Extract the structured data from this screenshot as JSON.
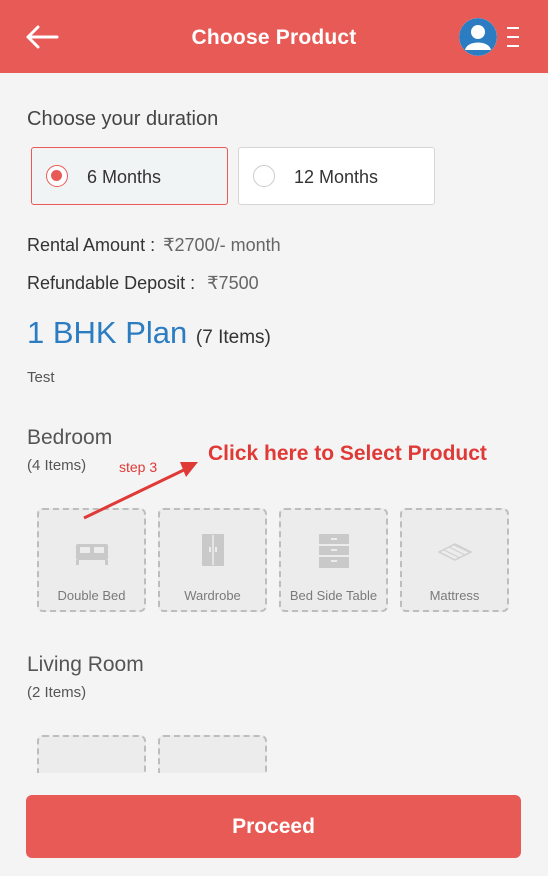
{
  "header": {
    "title": "Choose Product",
    "back_icon": "back-arrow-icon",
    "avatar_icon": "user-avatar-icon",
    "menu_icon": "menu-icon"
  },
  "duration": {
    "heading": "Choose your duration",
    "options": [
      {
        "label": "6 Months",
        "selected": true
      },
      {
        "label": "12 Months",
        "selected": false
      }
    ]
  },
  "pricing": {
    "rental_label": "Rental Amount :",
    "rental_value": "₹2700/- month",
    "deposit_label": "Refundable Deposit :",
    "deposit_value": "₹7500"
  },
  "plan": {
    "name": "1 BHK Plan",
    "items": "(7 Items)",
    "description": "Test"
  },
  "rooms": [
    {
      "name": "Bedroom",
      "count": "(4 Items)",
      "products": [
        {
          "label": "Double Bed",
          "icon": "bed-icon"
        },
        {
          "label": "Wardrobe",
          "icon": "wardrobe-icon"
        },
        {
          "label": "Bed Side Table",
          "icon": "drawer-icon"
        },
        {
          "label": "Mattress",
          "icon": "mattress-icon"
        }
      ]
    },
    {
      "name": "Living Room",
      "count": "(2 Items)",
      "products": [
        {
          "label": "",
          "icon": "sofa-icon"
        },
        {
          "label": "",
          "icon": "table-icon"
        }
      ]
    }
  ],
  "annotation": {
    "text": "Click here to Select Product",
    "step": "step 3"
  },
  "footer": {
    "proceed_label": "Proceed"
  },
  "colors": {
    "accent": "#e85a56",
    "plan_blue": "#2b7cc1",
    "annotation_red": "#e03a36"
  }
}
